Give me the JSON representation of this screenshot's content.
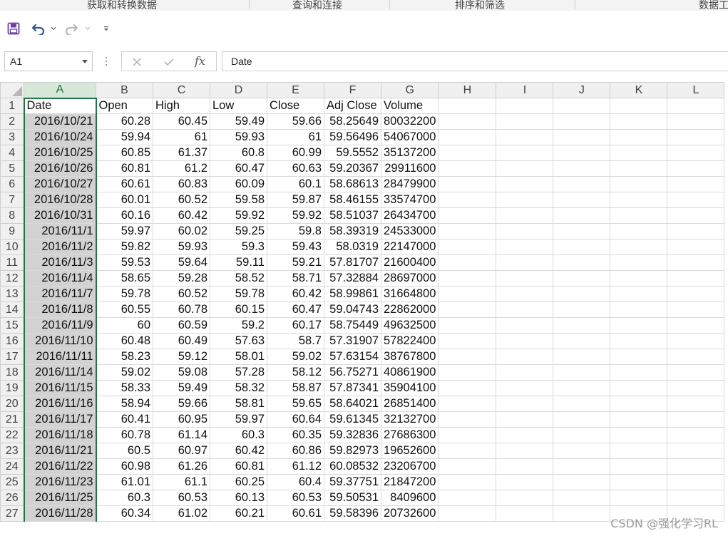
{
  "ribbon": {
    "groups": [
      "获取和转换数据",
      "查询和连接",
      "排序和筛选",
      "数据工"
    ]
  },
  "quick_access": {
    "icons": [
      "save-icon",
      "undo-icon",
      "undo-dropdown-icon",
      "redo-icon",
      "redo-dropdown-icon",
      "customize-qat-icon"
    ]
  },
  "formula_bar": {
    "name_box": "A1",
    "cancel_icon": "cancel-icon",
    "enter_icon": "check-icon",
    "fx_label": "fx",
    "value": "Date"
  },
  "sheet": {
    "columns": [
      "A",
      "B",
      "C",
      "D",
      "E",
      "F",
      "G",
      "H",
      "I",
      "J",
      "K",
      "L"
    ],
    "headers": [
      "Date",
      "Open",
      "High",
      "Low",
      "Close",
      "Adj Close",
      "Volume"
    ],
    "rows": [
      [
        "2016/10/21",
        "60.28",
        "60.45",
        "59.49",
        "59.66",
        "58.25649",
        "80032200"
      ],
      [
        "2016/10/24",
        "59.94",
        "61",
        "59.93",
        "61",
        "59.56496",
        "54067000"
      ],
      [
        "2016/10/25",
        "60.85",
        "61.37",
        "60.8",
        "60.99",
        "59.5552",
        "35137200"
      ],
      [
        "2016/10/26",
        "60.81",
        "61.2",
        "60.47",
        "60.63",
        "59.20367",
        "29911600"
      ],
      [
        "2016/10/27",
        "60.61",
        "60.83",
        "60.09",
        "60.1",
        "58.68613",
        "28479900"
      ],
      [
        "2016/10/28",
        "60.01",
        "60.52",
        "59.58",
        "59.87",
        "58.46155",
        "33574700"
      ],
      [
        "2016/10/31",
        "60.16",
        "60.42",
        "59.92",
        "59.92",
        "58.51037",
        "26434700"
      ],
      [
        "2016/11/1",
        "59.97",
        "60.02",
        "59.25",
        "59.8",
        "58.39319",
        "24533000"
      ],
      [
        "2016/11/2",
        "59.82",
        "59.93",
        "59.3",
        "59.43",
        "58.0319",
        "22147000"
      ],
      [
        "2016/11/3",
        "59.53",
        "59.64",
        "59.11",
        "59.21",
        "57.81707",
        "21600400"
      ],
      [
        "2016/11/4",
        "58.65",
        "59.28",
        "58.52",
        "58.71",
        "57.32884",
        "28697000"
      ],
      [
        "2016/11/7",
        "59.78",
        "60.52",
        "59.78",
        "60.42",
        "58.99861",
        "31664800"
      ],
      [
        "2016/11/8",
        "60.55",
        "60.78",
        "60.15",
        "60.47",
        "59.04743",
        "22862000"
      ],
      [
        "2016/11/9",
        "60",
        "60.59",
        "59.2",
        "60.17",
        "58.75449",
        "49632500"
      ],
      [
        "2016/11/10",
        "60.48",
        "60.49",
        "57.63",
        "58.7",
        "57.31907",
        "57822400"
      ],
      [
        "2016/11/11",
        "58.23",
        "59.12",
        "58.01",
        "59.02",
        "57.63154",
        "38767800"
      ],
      [
        "2016/11/14",
        "59.02",
        "59.08",
        "57.28",
        "58.12",
        "56.75271",
        "40861900"
      ],
      [
        "2016/11/15",
        "58.33",
        "59.49",
        "58.32",
        "58.87",
        "57.87341",
        "35904100"
      ],
      [
        "2016/11/16",
        "58.94",
        "59.66",
        "58.81",
        "59.65",
        "58.64021",
        "26851400"
      ],
      [
        "2016/11/17",
        "60.41",
        "60.95",
        "59.97",
        "60.64",
        "59.61345",
        "32132700"
      ],
      [
        "2016/11/18",
        "60.78",
        "61.14",
        "60.3",
        "60.35",
        "59.32836",
        "27686300"
      ],
      [
        "2016/11/21",
        "60.5",
        "60.97",
        "60.42",
        "60.86",
        "59.82973",
        "19652600"
      ],
      [
        "2016/11/22",
        "60.98",
        "61.26",
        "60.81",
        "61.12",
        "60.08532",
        "23206700"
      ],
      [
        "2016/11/23",
        "61.01",
        "61.1",
        "60.25",
        "60.4",
        "59.37751",
        "21847200"
      ],
      [
        "2016/11/25",
        "60.3",
        "60.53",
        "60.13",
        "60.53",
        "59.50531",
        "8409600"
      ],
      [
        "2016/11/28",
        "60.34",
        "61.02",
        "60.21",
        "60.61",
        "59.58396",
        "20732600"
      ]
    ]
  },
  "watermark": "CSDN @强化学习RL",
  "colors": {
    "accent": "#217346",
    "selected_column_fill": "#d2d2d2",
    "header_fill": "#f0f0f0"
  }
}
